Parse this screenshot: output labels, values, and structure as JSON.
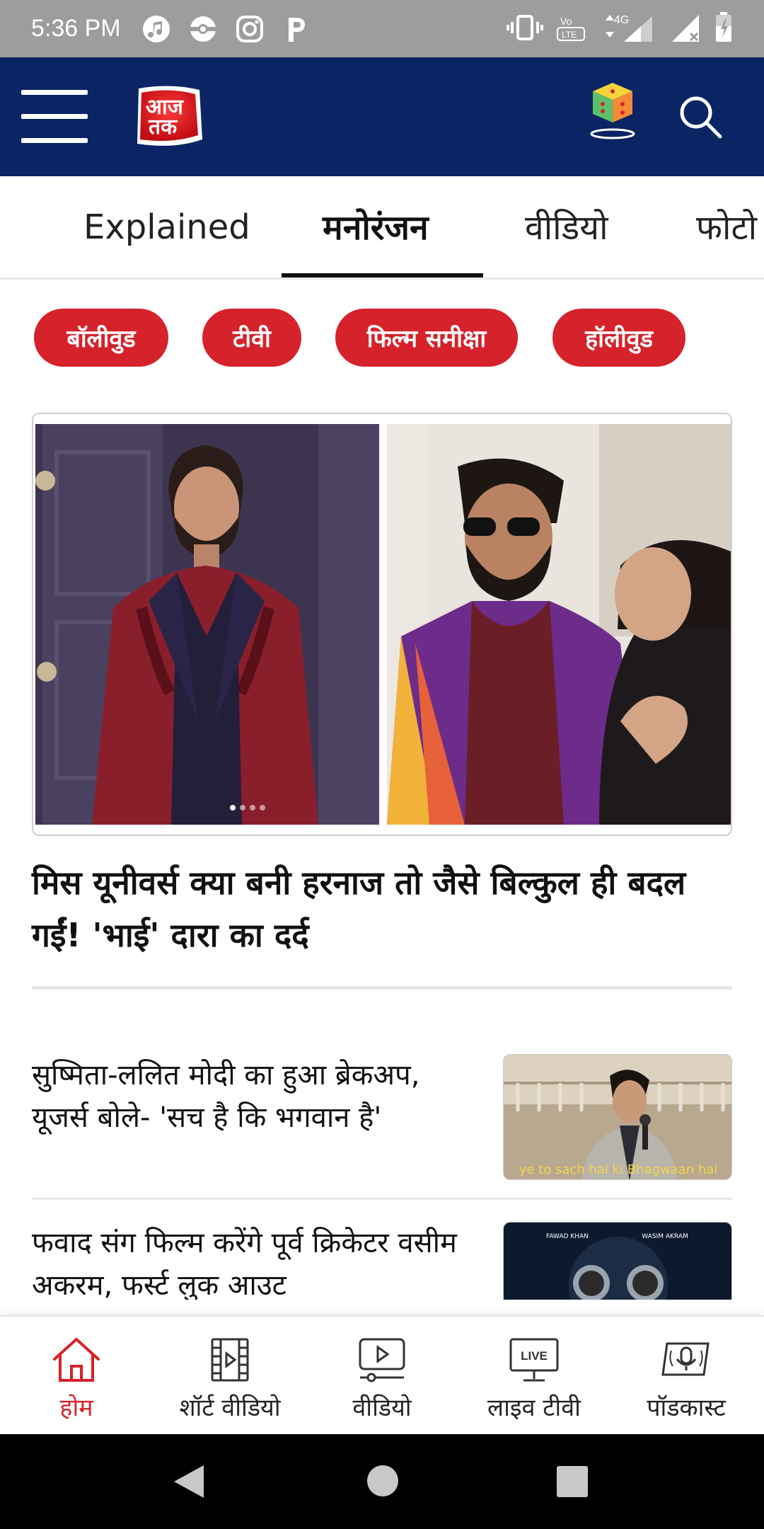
{
  "status_bar": {
    "time": "5:36 PM",
    "apps": [
      "music-icon",
      "pokeball-icon",
      "instagram-icon",
      "parking-icon"
    ],
    "network": "4G",
    "volte": "VoLTE"
  },
  "header": {
    "logo_text": "आज तक"
  },
  "tabs": [
    {
      "label": "Explained"
    },
    {
      "label": "मनोरंजन"
    },
    {
      "label": "वीडियो"
    },
    {
      "label": "फोटो"
    }
  ],
  "chips": [
    {
      "label": "बॉलीवुड"
    },
    {
      "label": "टीवी"
    },
    {
      "label": "फिल्म समीक्षा"
    },
    {
      "label": "हॉलीवुड"
    }
  ],
  "hero": {
    "headline": "मिस यूनीवर्स क्या बनी हरनाज तो जैसे बिल्कुल ही बदल गईं! 'भाई' दारा का दर्द"
  },
  "stories": [
    {
      "title": "सुष्मिता-ललित मोदी का हुआ ब्रेकअप, यूजर्स बोले- 'सच है कि भगवान है'",
      "thumb_caption": "ye to sach hai ki Bhagwaan hai"
    },
    {
      "title": "फवाद संग फिल्म करेंगे पूर्व क्रिकेटर वसीम अकरम, फर्स्ट लुक आउट",
      "thumb_caption_left": "FAWAD KHAN",
      "thumb_caption_right": "WASIM AKRAM"
    }
  ],
  "bottom_nav": [
    {
      "label": "होम"
    },
    {
      "label": "शॉर्ट वीडियो"
    },
    {
      "label": "वीडियो"
    },
    {
      "label": "लाइव टीवी",
      "badge": "LIVE"
    },
    {
      "label": "पॉडकास्ट"
    }
  ],
  "colors": {
    "brand_navy": "#0b2463",
    "brand_red": "#d6222a"
  }
}
